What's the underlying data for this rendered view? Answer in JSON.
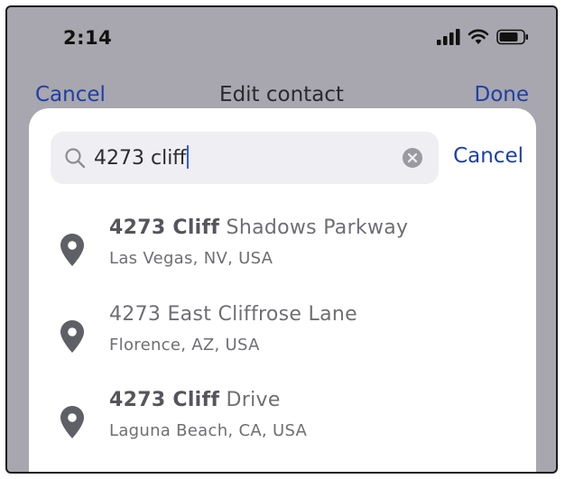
{
  "status_bar": {
    "time": "2:14",
    "icons": [
      "cellular-signal-icon",
      "wifi-icon",
      "battery-icon"
    ]
  },
  "background_nav": {
    "cancel_label": "Cancel",
    "title": "Edit contact",
    "done_label": "Done"
  },
  "search": {
    "value": "4273 cliff",
    "cancel_label": "Cancel"
  },
  "results": [
    {
      "match": "4273 Cliff",
      "rest": " Shadows Parkway",
      "subtitle": "Las Vegas, NV, USA"
    },
    {
      "match": "",
      "rest": "4273 East Cliffrose Lane",
      "subtitle": "Florence, AZ, USA"
    },
    {
      "match": "4273 Cliff",
      "rest": " Drive",
      "subtitle": "Laguna Beach, CA, USA"
    }
  ],
  "colors": {
    "accent": "#1d3fa6",
    "dimmed_background": "#a8a6ae",
    "search_field": "#efeff3",
    "caret": "#2b5cf0",
    "icon_gray": "#5f5f66"
  }
}
